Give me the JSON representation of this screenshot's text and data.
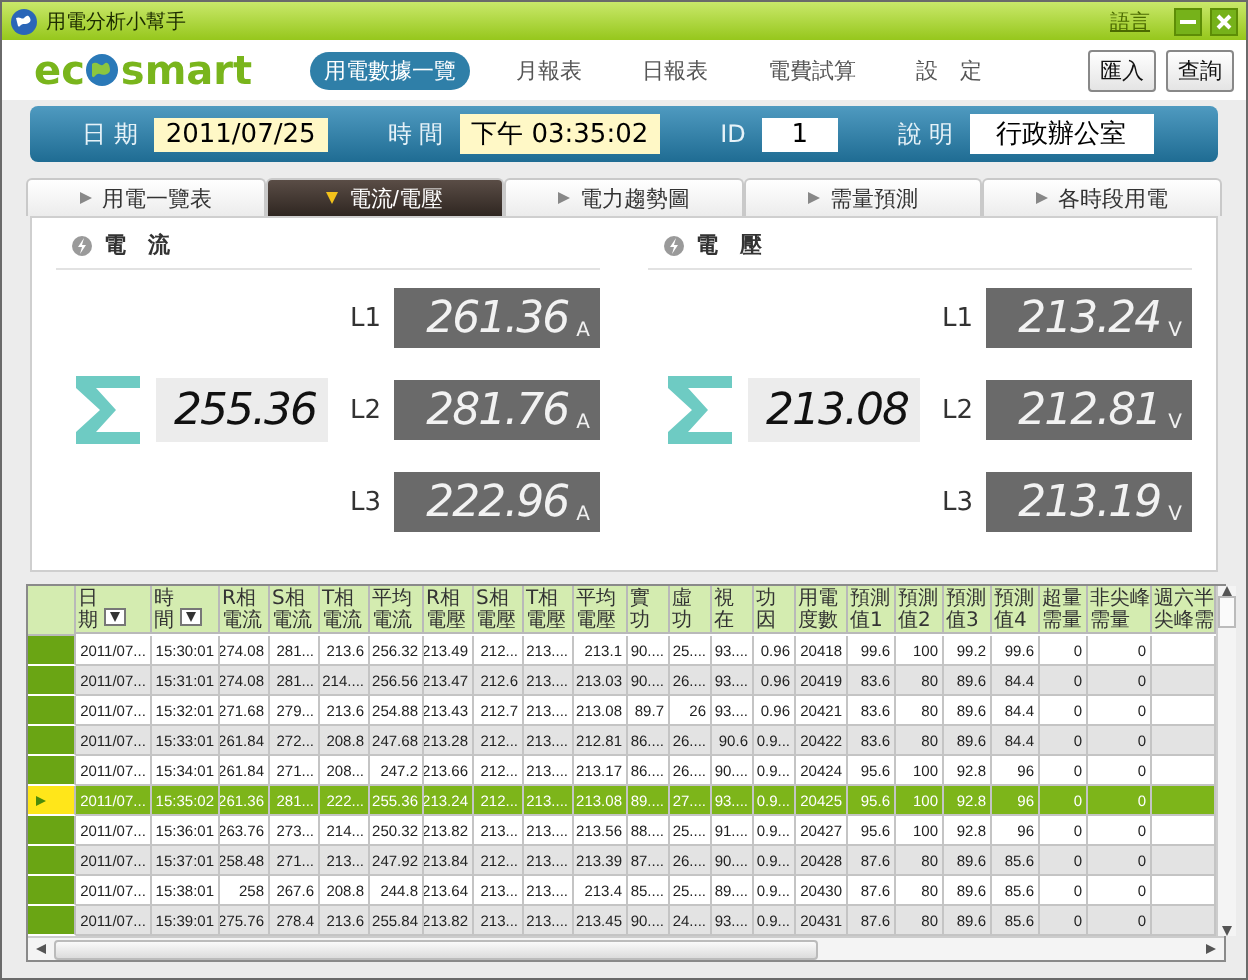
{
  "window": {
    "title": "用電分析小幫手",
    "language_link": "語言"
  },
  "logo": {
    "left": "ec",
    "right": "smart"
  },
  "nav": {
    "items": [
      {
        "label": "用電數據一覽",
        "selected": true
      },
      {
        "label": "月報表",
        "selected": false
      },
      {
        "label": "日報表",
        "selected": false
      },
      {
        "label": "電費試算",
        "selected": false
      },
      {
        "label": "設　定",
        "selected": false
      }
    ],
    "buttons": [
      "匯入",
      "查詢"
    ]
  },
  "info_bar": {
    "fields": [
      {
        "label": "日 期",
        "value": "2011/07/25",
        "kind": "highlight"
      },
      {
        "label": "時 間",
        "value": "下午 03:35:02",
        "kind": "highlight"
      },
      {
        "label": "ID",
        "value": "1",
        "kind": "plain"
      },
      {
        "label": "說 明",
        "value": "行政辦公室",
        "kind": "plain"
      }
    ]
  },
  "tabs": [
    {
      "label": "用電一覽表",
      "selected": false
    },
    {
      "label": "電流/電壓",
      "selected": true
    },
    {
      "label": "電力趨勢圖",
      "selected": false
    },
    {
      "label": "需量預測",
      "selected": false
    },
    {
      "label": "各時段用電",
      "selected": false
    }
  ],
  "readings": [
    {
      "title": "電　流",
      "total": "255.36",
      "phases": [
        {
          "name": "L1",
          "value": "261.36",
          "unit": "A"
        },
        {
          "name": "L2",
          "value": "281.76",
          "unit": "A"
        },
        {
          "name": "L3",
          "value": "222.96",
          "unit": "A"
        }
      ]
    },
    {
      "title": "電　壓",
      "total": "213.08",
      "phases": [
        {
          "name": "L1",
          "value": "213.24",
          "unit": "V"
        },
        {
          "name": "L2",
          "value": "212.81",
          "unit": "V"
        },
        {
          "name": "L3",
          "value": "213.19",
          "unit": "V"
        }
      ]
    }
  ],
  "table": {
    "columns": [
      {
        "label": "日期",
        "filter": true
      },
      {
        "label": "時間",
        "filter": true
      },
      {
        "label": "R相電流"
      },
      {
        "label": "S相電流"
      },
      {
        "label": "T相電流"
      },
      {
        "label": "平均電流"
      },
      {
        "label": "R相電壓"
      },
      {
        "label": "S相電壓"
      },
      {
        "label": "T相電壓"
      },
      {
        "label": "平均電壓"
      },
      {
        "label": "實功"
      },
      {
        "label": "虛功"
      },
      {
        "label": "視在"
      },
      {
        "label": "功因"
      },
      {
        "label": "用電度數"
      },
      {
        "label": "預測值1"
      },
      {
        "label": "預測值2"
      },
      {
        "label": "預測值3"
      },
      {
        "label": "預測值4"
      },
      {
        "label": "超量需量"
      },
      {
        "label": "非尖峰需量"
      },
      {
        "label": "週六半尖峰需"
      }
    ],
    "rows": [
      {
        "selected": false,
        "cells": [
          "2011/07...",
          "15:30:01",
          "274.08",
          "281...",
          "213.6",
          "256.32",
          "213.49",
          "212...",
          "213....",
          "213.1",
          "90....",
          "25....",
          "93....",
          "0.96",
          "20418",
          "99.6",
          "100",
          "99.2",
          "99.6",
          "0",
          "0"
        ]
      },
      {
        "selected": false,
        "cells": [
          "2011/07...",
          "15:31:01",
          "274.08",
          "281...",
          "214....",
          "256.56",
          "213.47",
          "212.6",
          "213....",
          "213.03",
          "90....",
          "26....",
          "93....",
          "0.96",
          "20419",
          "83.6",
          "80",
          "89.6",
          "84.4",
          "0",
          "0"
        ]
      },
      {
        "selected": false,
        "cells": [
          "2011/07...",
          "15:32:01",
          "271.68",
          "279...",
          "213.6",
          "254.88",
          "213.43",
          "212.7",
          "213....",
          "213.08",
          "89.7",
          "26",
          "93....",
          "0.96",
          "20421",
          "83.6",
          "80",
          "89.6",
          "84.4",
          "0",
          "0"
        ]
      },
      {
        "selected": false,
        "cells": [
          "2011/07...",
          "15:33:01",
          "261.84",
          "272...",
          "208.8",
          "247.68",
          "213.28",
          "212...",
          "213....",
          "212.81",
          "86....",
          "26....",
          "90.6",
          "0.9...",
          "20422",
          "83.6",
          "80",
          "89.6",
          "84.4",
          "0",
          "0"
        ]
      },
      {
        "selected": false,
        "cells": [
          "2011/07...",
          "15:34:01",
          "261.84",
          "271...",
          "208...",
          "247.2",
          "213.66",
          "212...",
          "213....",
          "213.17",
          "86....",
          "26....",
          "90....",
          "0.9...",
          "20424",
          "95.6",
          "100",
          "92.8",
          "96",
          "0",
          "0"
        ]
      },
      {
        "selected": true,
        "cells": [
          "2011/07...",
          "15:35:02",
          "261.36",
          "281...",
          "222...",
          "255.36",
          "213.24",
          "212...",
          "213....",
          "213.08",
          "89....",
          "27....",
          "93....",
          "0.9...",
          "20425",
          "95.6",
          "100",
          "92.8",
          "96",
          "0",
          "0"
        ]
      },
      {
        "selected": false,
        "cells": [
          "2011/07...",
          "15:36:01",
          "263.76",
          "273...",
          "214...",
          "250.32",
          "213.82",
          "213...",
          "213....",
          "213.56",
          "88....",
          "25....",
          "91....",
          "0.9...",
          "20427",
          "95.6",
          "100",
          "92.8",
          "96",
          "0",
          "0"
        ]
      },
      {
        "selected": false,
        "cells": [
          "2011/07...",
          "15:37:01",
          "258.48",
          "271...",
          "213...",
          "247.92",
          "213.84",
          "212...",
          "213....",
          "213.39",
          "87....",
          "26....",
          "90....",
          "0.9...",
          "20428",
          "87.6",
          "80",
          "89.6",
          "85.6",
          "0",
          "0"
        ]
      },
      {
        "selected": false,
        "cells": [
          "2011/07...",
          "15:38:01",
          "258",
          "267.6",
          "208.8",
          "244.8",
          "213.64",
          "213...",
          "213....",
          "213.4",
          "85....",
          "25....",
          "89....",
          "0.9...",
          "20430",
          "87.6",
          "80",
          "89.6",
          "85.6",
          "0",
          "0"
        ]
      },
      {
        "selected": false,
        "cells": [
          "2011/07...",
          "15:39:01",
          "275.76",
          "278.4",
          "213.6",
          "255.84",
          "213.82",
          "213...",
          "213....",
          "213.45",
          "90....",
          "24....",
          "93....",
          "0.9...",
          "20431",
          "87.6",
          "80",
          "89.6",
          "85.6",
          "0",
          "0"
        ]
      }
    ]
  }
}
